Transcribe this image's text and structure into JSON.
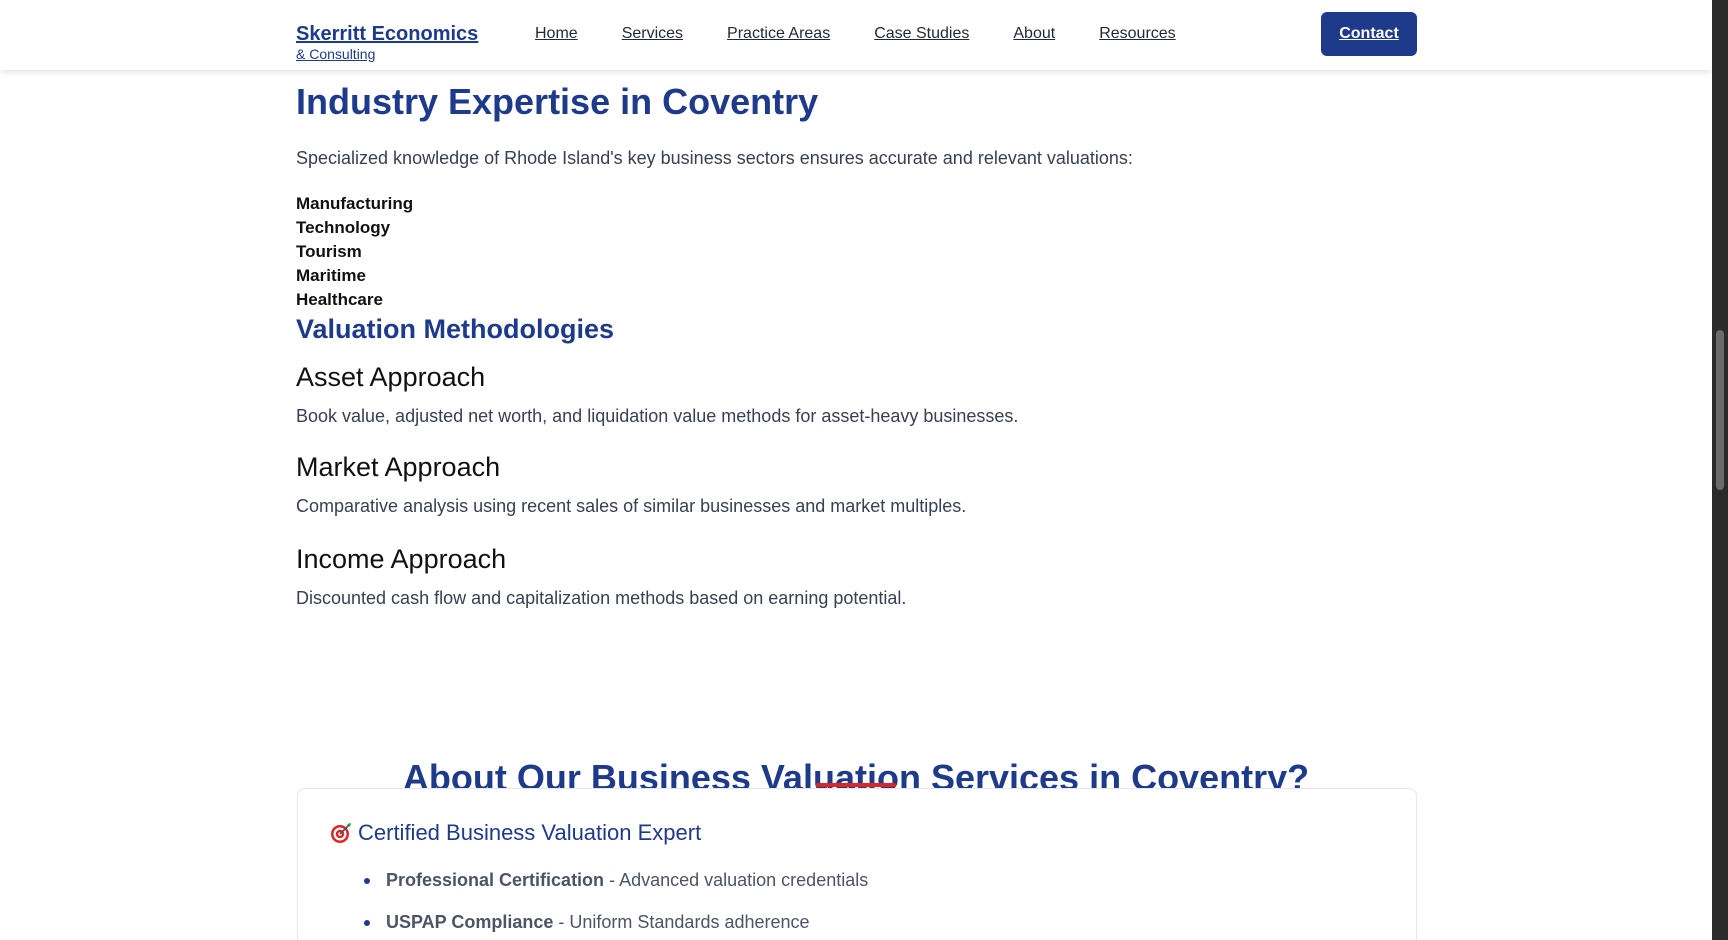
{
  "header": {
    "brand_name": "Skerritt Economics",
    "brand_sub": "& Consulting",
    "nav": [
      "Home",
      "Services",
      "Practice Areas",
      "Case Studies",
      "About",
      "Resources"
    ],
    "contact_label": "Contact"
  },
  "industry": {
    "title": "Industry Expertise in Coventry",
    "intro": "Specialized knowledge of Rhode Island's key business sectors ensures accurate and relevant valuations:",
    "sectors": [
      "Manufacturing",
      "Technology",
      "Tourism",
      "Maritime",
      "Healthcare"
    ]
  },
  "methods": {
    "title": "Valuation Methodologies",
    "approaches": [
      {
        "title": "Asset Approach",
        "desc": "Book value, adjusted net worth, and liquidation value methods for asset-heavy businesses."
      },
      {
        "title": "Market Approach",
        "desc": "Comparative analysis using recent sales of similar businesses and market multiples."
      },
      {
        "title": "Income Approach",
        "desc": "Discounted cash flow and capitalization methods based on earning potential."
      }
    ]
  },
  "about": {
    "title": "About Our Business Valuation Services in Coventry?",
    "accent_color": "#dc2626",
    "card": {
      "icon": "target-icon",
      "title": "Certified Business Valuation Expert",
      "items": [
        {
          "strong": "Professional Certification",
          "rest": " - Advanced valuation credentials"
        },
        {
          "strong": "USPAP Compliance",
          "rest": " - Uniform Standards adherence"
        }
      ]
    }
  },
  "colors": {
    "brand": "#1e3a8a",
    "accent": "#dc2626"
  }
}
